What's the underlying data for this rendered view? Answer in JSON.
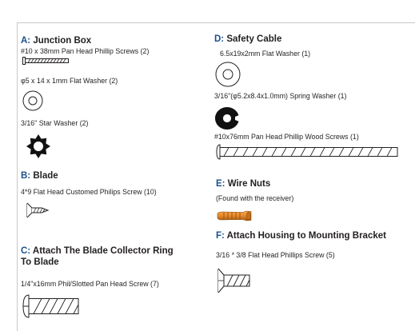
{
  "sections": {
    "a": {
      "letter": "A:",
      "title": " Junction Box",
      "items": [
        "#10 x 38mm Pan Head Phillip Screws (2)",
        "φ5 x 14 x 1mm Flat Washer (2)",
        "3/16\" Star Washer (2)"
      ]
    },
    "b": {
      "letter": "B:",
      "title": " Blade",
      "items": [
        "4*9 Flat Head Customed Philips Screw (10)"
      ]
    },
    "c": {
      "letter": "C:",
      "title_line1": " Attach The Blade Collector Ring",
      "title_line2": "To Blade",
      "items": [
        "1/4\"x16mm Phil/Slotted Pan Head Screw (7)"
      ]
    },
    "d": {
      "letter": "D:",
      "title": " Safety Cable",
      "items": [
        "6.5x19x2mm Flat Washer (1)",
        "3/16\"(φ5.2x8.4x1.0mm) Spring Washer (1)",
        "#10x76mm Pan Head Phillip Wood Screws (1)"
      ]
    },
    "e": {
      "letter": "E:",
      "title": " Wire Nuts",
      "items": [
        "(Found with the receiver)"
      ]
    },
    "f": {
      "letter": "F:",
      "title": " Attach Housing to Mounting Bracket",
      "items": [
        "3/16 * 3/8 Flat Head Phillips Screw (5)"
      ]
    },
    "colors": {
      "letter": "#1d4f8c",
      "text": "#231f20",
      "wire_nut": "#e8892a"
    }
  }
}
